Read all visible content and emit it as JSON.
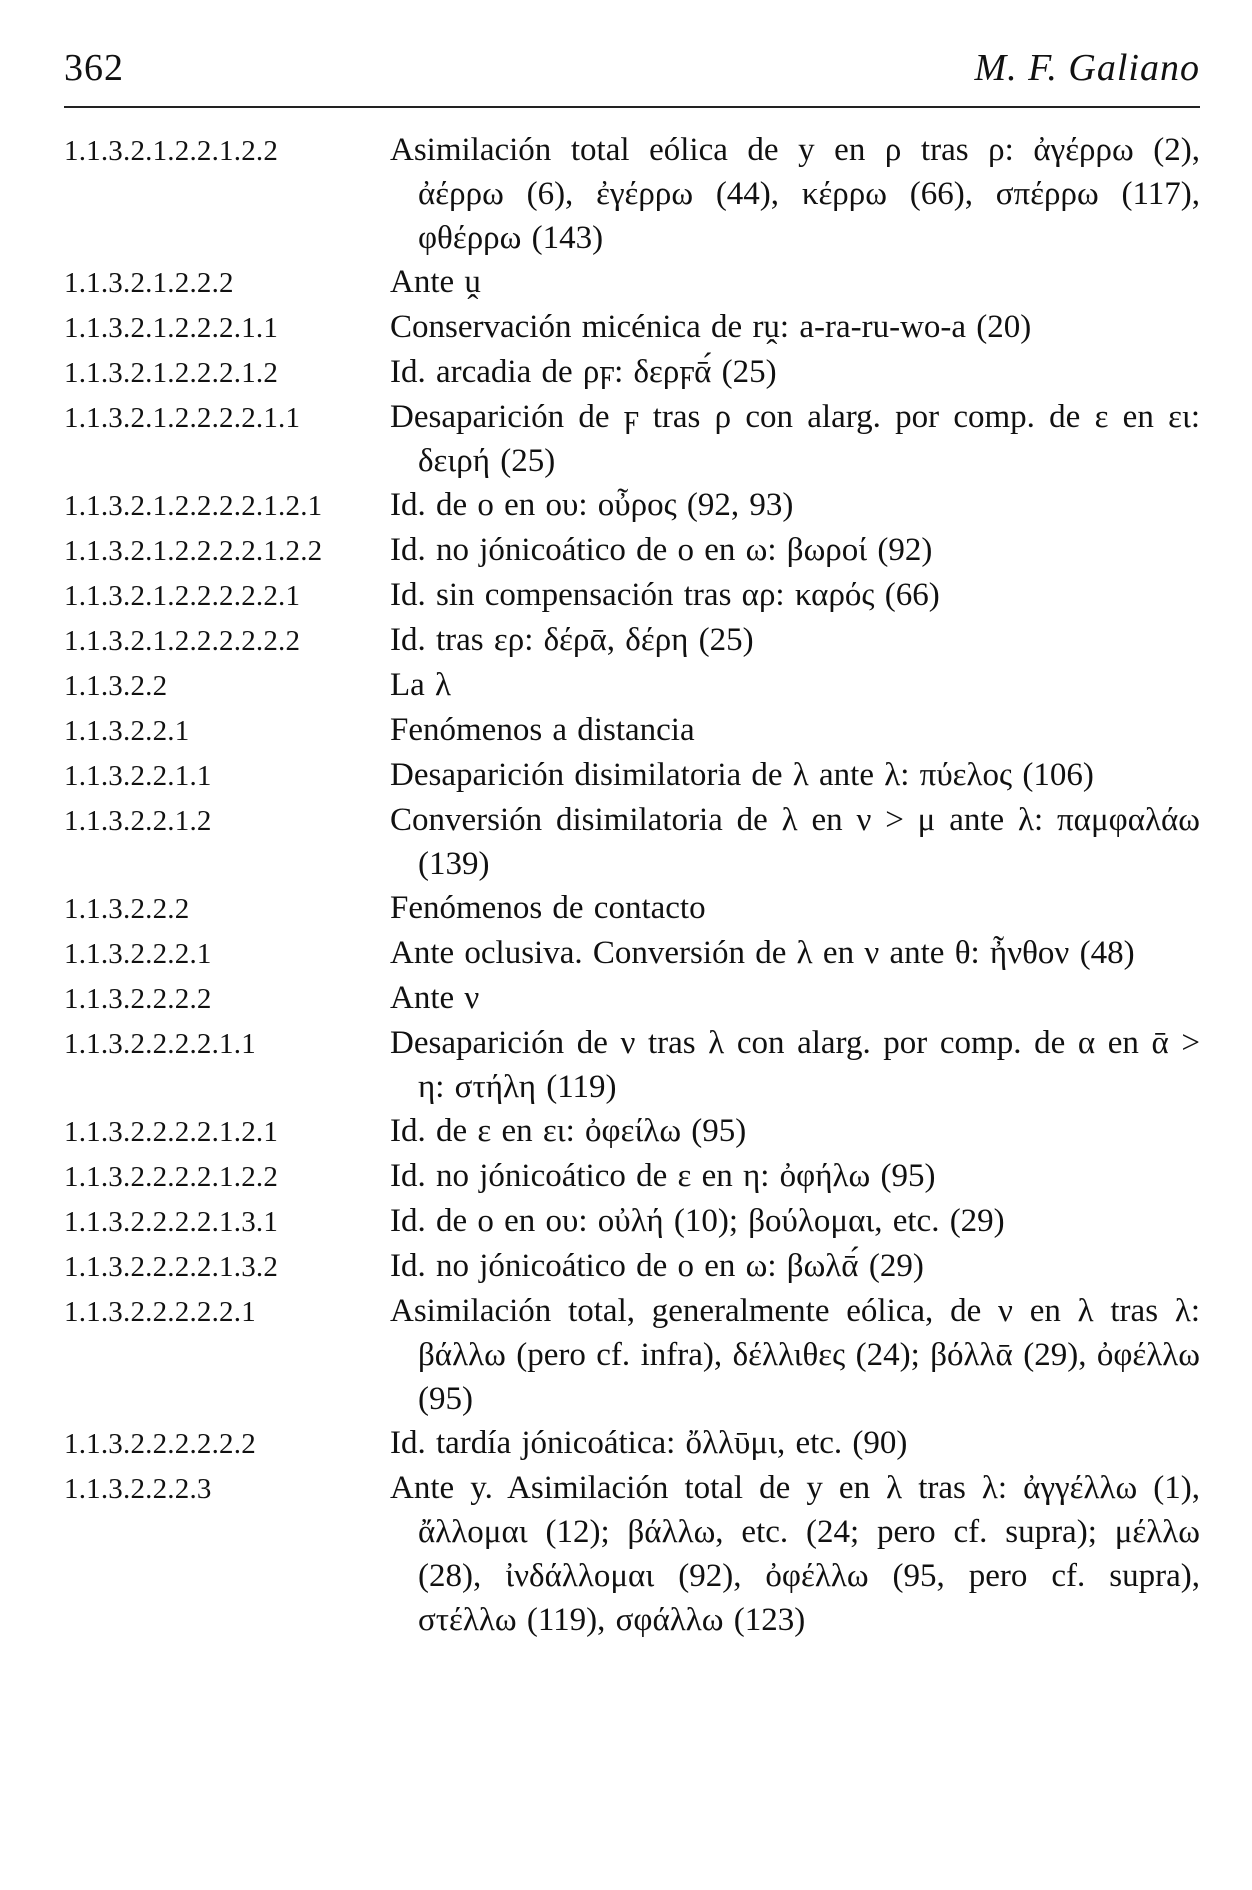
{
  "header": {
    "page_number": "362",
    "running_head": "M. F. Galiano"
  },
  "entries": [
    {
      "code": "1.1.3.2.1.2.2.1.2.2",
      "text": "Asimilación total eólica de y en ρ tras ρ: ἀγέρρω (2), ἀέρρω (6), ἐγέρρω (44), κέρρω (66), σπέρρω (117), φθέρρω (143)"
    },
    {
      "code": "1.1.3.2.1.2.2.2",
      "text": "Ante ṷ"
    },
    {
      "code": "1.1.3.2.1.2.2.2.1.1",
      "text": "Conservación micénica de rṷ: a-ra-ru-wo-a (20)"
    },
    {
      "code": "1.1.3.2.1.2.2.2.1.2",
      "text": "Id. arcadia de ρϝ: δερϝᾱ́ (25)"
    },
    {
      "code": "1.1.3.2.1.2.2.2.2.1.1",
      "text": "Desaparición de ϝ tras ρ con alarg. por comp. de ε en ει: δειρή (25)"
    },
    {
      "code": "1.1.3.2.1.2.2.2.2.1.2.1",
      "text": "Id. de ο en ου: οὖρος (92, 93)"
    },
    {
      "code": "1.1.3.2.1.2.2.2.2.1.2.2",
      "text": "Id. no jónicoático de ο en ω: βωροί (92)"
    },
    {
      "code": "1.1.3.2.1.2.2.2.2.2.1",
      "text": "Id. sin compensación tras αρ: καρός (66)"
    },
    {
      "code": "1.1.3.2.1.2.2.2.2.2.2",
      "text": "Id. tras ερ: δέρᾱ, δέρη (25)"
    },
    {
      "code": "1.1.3.2.2",
      "text": "La λ"
    },
    {
      "code": "1.1.3.2.2.1",
      "text": "Fenómenos a distancia"
    },
    {
      "code": "1.1.3.2.2.1.1",
      "text": "Desaparición disimilatoria de λ ante λ: πύελος (106)"
    },
    {
      "code": "1.1.3.2.2.1.2",
      "text": "Conversión disimilatoria de λ en ν > μ ante λ: παμφαλάω (139)"
    },
    {
      "code": "1.1.3.2.2.2",
      "text": "Fenómenos de contacto"
    },
    {
      "code": "1.1.3.2.2.2.1",
      "text": "Ante oclusiva. Conversión de λ en ν ante θ: ἦνθον (48)"
    },
    {
      "code": "1.1.3.2.2.2.2",
      "text": "Ante ν"
    },
    {
      "code": "1.1.3.2.2.2.2.1.1",
      "text": "Desaparición de ν tras λ con alarg. por comp. de α en ᾱ > η: στήλη (119)"
    },
    {
      "code": "1.1.3.2.2.2.2.1.2.1",
      "text": "Id. de ε en ει: ὀφείλω (95)"
    },
    {
      "code": "1.1.3.2.2.2.2.1.2.2",
      "text": "Id. no jónicoático de ε en η: ὀφήλω (95)"
    },
    {
      "code": "1.1.3.2.2.2.2.1.3.1",
      "text": "Id. de ο en ου: οὐλή (10); βούλομαι, etc. (29)"
    },
    {
      "code": "1.1.3.2.2.2.2.1.3.2",
      "text": "Id. no jónicoático de ο en ω: βωλᾱ́ (29)"
    },
    {
      "code": "1.1.3.2.2.2.2.2.1",
      "text": "Asimilación total, generalmente eólica, de ν en λ tras λ: βάλλω (pero cf. infra), δέλλιθες (24); βόλλᾱ (29), ὀφέλλω (95)"
    },
    {
      "code": "1.1.3.2.2.2.2.2.2",
      "text": "Id. tardía jónicoática: ὄλλῡμι, etc. (90)"
    },
    {
      "code": "1.1.3.2.2.2.3",
      "text": "Ante y. Asimilación total de y en λ tras λ: ἀγγέλλω (1), ἄλλομαι (12); βάλλω, etc. (24; pero cf. supra); μέλλω (28), ἰνδάλλομαι (92), ὀφέλλω (95, pero cf. supra), στέλλω (119), σφάλλω (123)"
    }
  ]
}
